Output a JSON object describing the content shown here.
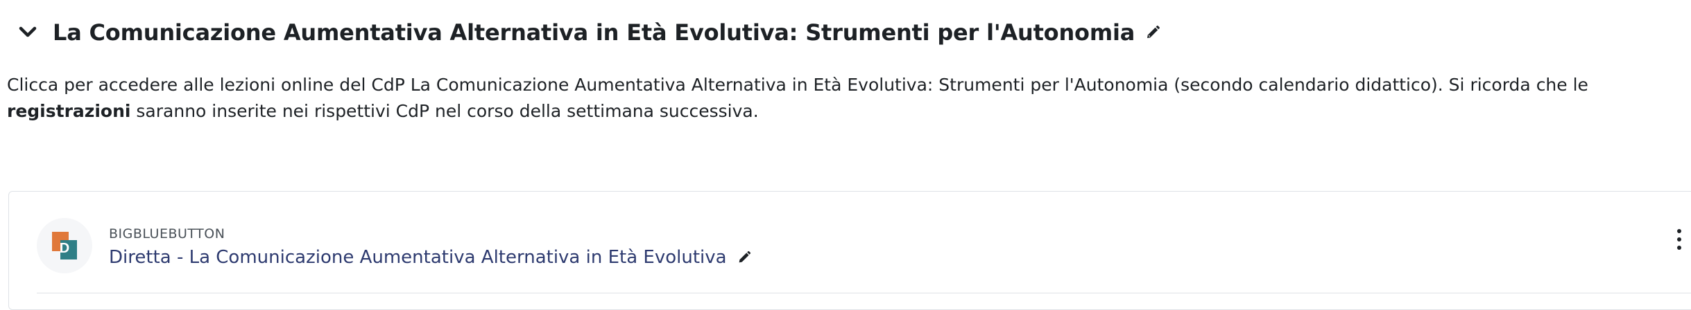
{
  "section": {
    "title": "La Comunicazione Aumentativa Alternativa in Età Evolutiva: Strumenti per l'Autonomia",
    "summary_part1": "Clicca per accedere alle lezioni online del CdP La Comunicazione Aumentativa Alternativa in Età Evolutiva: Strumenti per l'Autonomia (secondo calendario didattico).  Si ricorda che le ",
    "summary_bold": "registrazioni",
    "summary_part2": " saranno inserite nei rispettivi CdP nel corso della settimana successiva."
  },
  "activity": {
    "type": "BIGBLUEBUTTON",
    "name": "Diretta - La Comunicazione Aumentativa Alternativa in Età Evolutiva",
    "icon_letter": "D"
  },
  "icons": {
    "collapse": "chevron-down-icon",
    "edit": "pencil-icon",
    "more": "more-vertical-icon"
  },
  "colors": {
    "text": "#1d2125",
    "link": "#2d3a6f",
    "icon_orange": "#e0783a",
    "icon_teal": "#2f7f86"
  }
}
